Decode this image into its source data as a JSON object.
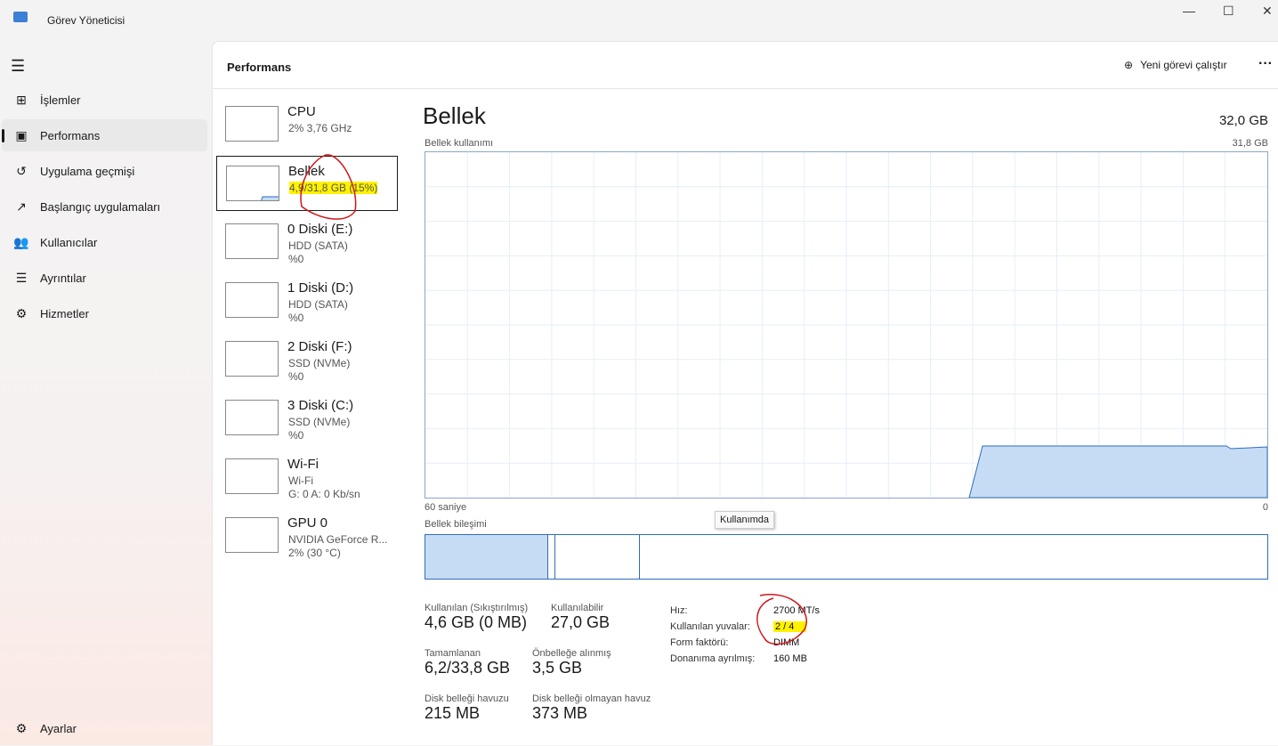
{
  "window": {
    "title": "Görev Yöneticisi",
    "minimize": "—",
    "maximize": "☐",
    "close": "✕"
  },
  "sidebar": {
    "items": [
      {
        "label": "İşlemler",
        "icon": "processes-icon",
        "glyph": "⊞"
      },
      {
        "label": "Performans",
        "icon": "performance-icon",
        "glyph": "▣",
        "selected": true
      },
      {
        "label": "Uygulama geçmişi",
        "icon": "history-icon",
        "glyph": "↺"
      },
      {
        "label": "Başlangıç uygulamaları",
        "icon": "startup-icon",
        "glyph": "↗"
      },
      {
        "label": "Kullanıcılar",
        "icon": "users-icon",
        "glyph": "👥"
      },
      {
        "label": "Ayrıntılar",
        "icon": "details-icon",
        "glyph": "☰"
      },
      {
        "label": "Hizmetler",
        "icon": "services-icon",
        "glyph": "⚙"
      }
    ],
    "settings": "Ayarlar"
  },
  "header": {
    "title": "Performans",
    "new_task": "Yeni görevi çalıştır",
    "more": "···"
  },
  "devices": [
    {
      "name": "CPU",
      "sub1": "2% 3,76 GHz",
      "sub2": ""
    },
    {
      "name": "Bellek",
      "sub1": "4,9/31,8 GB (15%)",
      "sub2": "",
      "selected": true
    },
    {
      "name": "0 Diski (E:)",
      "sub1": "HDD (SATA)",
      "sub2": "%0"
    },
    {
      "name": "1 Diski (D:)",
      "sub1": "HDD (SATA)",
      "sub2": "%0"
    },
    {
      "name": "2 Diski (F:)",
      "sub1": "SSD (NVMe)",
      "sub2": "%0"
    },
    {
      "name": "3 Diski (C:)",
      "sub1": "SSD (NVMe)",
      "sub2": "%0"
    },
    {
      "name": "Wi-Fi",
      "sub1": "Wi-Fi",
      "sub2": "G: 0 A: 0 Kb/sn"
    },
    {
      "name": "GPU 0",
      "sub1": "NVIDIA GeForce R...",
      "sub2": "2% (30 °C)"
    }
  ],
  "memory": {
    "title": "Bellek",
    "total": "32,0 GB",
    "usage_label": "Bellek kullanımı",
    "usage_max": "31,8 GB",
    "x_left": "60 saniye",
    "x_right": "0",
    "usage_fraction": 0.15,
    "composition_label": "Bellek bileşimi",
    "tooltip": "Kullanımda",
    "in_use_label": "Kullanılan (Sıkıştırılmış)",
    "in_use": "4,6 GB (0 MB)",
    "available_label": "Kullanılabilir",
    "available": "27,0 GB",
    "committed_label": "Tamamlanan",
    "committed": "6,2/33,8 GB",
    "cached_label": "Önbelleğe alınmış",
    "cached": "3,5 GB",
    "paged_label": "Disk belleği havuzu",
    "paged": "215 MB",
    "nonpaged_label": "Disk belleği olmayan havuz",
    "nonpaged": "373 MB",
    "speed_label": "Hız:",
    "speed": "2700 MT/s",
    "slots_label": "Kullanılan yuvalar:",
    "slots": "2 / 4",
    "form_label": "Form faktörü:",
    "form": "DIMM",
    "reserved_label": "Donanıma ayrılmış:",
    "reserved": "160 MB"
  },
  "colors": {
    "accent": "#2e6dbf",
    "fill": "#c6dcf5",
    "highlight": "#fff200",
    "annotation": "#d0161b"
  }
}
